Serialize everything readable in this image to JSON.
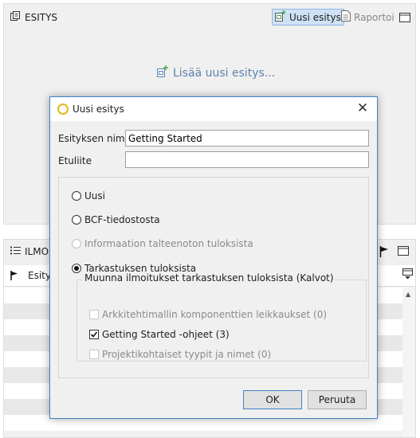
{
  "top_panel": {
    "title": "ESITYS",
    "new_button": "Uusi esitys",
    "report_button": "Raportoi",
    "add_link": "Lisää uusi esitys..."
  },
  "bottom_panel": {
    "title": "ILMO",
    "column_label": "Esitys"
  },
  "dialog": {
    "title": "Uusi esitys",
    "name_label": "Esityksen nimi",
    "name_value": "Getting Started",
    "prefix_label": "Etuliite",
    "prefix_value": "",
    "radio_options": [
      {
        "label": "Uusi",
        "checked": false,
        "disabled": false
      },
      {
        "label": "BCF-tiedostosta",
        "checked": false,
        "disabled": false
      },
      {
        "label": "Informaation talteenoton tuloksista",
        "checked": false,
        "disabled": true
      },
      {
        "label": "Tarkastuksen tuloksista",
        "checked": true,
        "disabled": false
      }
    ],
    "group_title": "Muunna ilmoitukset tarkastuksen tuloksista (Kalvot)",
    "checkboxes": [
      {
        "label": "Arkkitehtimallin komponenttien leikkaukset (0)",
        "checked": false,
        "disabled": true
      },
      {
        "label": "Getting Started -ohjeet (3)",
        "checked": true,
        "disabled": false
      },
      {
        "label": "Projektikohtaiset tyypit ja nimet (0)",
        "checked": false,
        "disabled": true
      }
    ],
    "ok_label": "OK",
    "cancel_label": "Peruuta"
  }
}
